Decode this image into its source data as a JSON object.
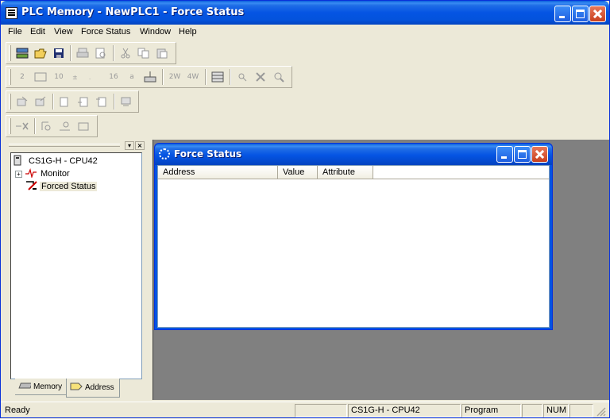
{
  "window": {
    "title": "PLC Memory - NewPLC1 - Force Status"
  },
  "menu": {
    "items": [
      {
        "label": "File"
      },
      {
        "label": "Edit"
      },
      {
        "label": "View"
      },
      {
        "label": "Force Status"
      },
      {
        "label": "Window"
      },
      {
        "label": "Help"
      }
    ]
  },
  "toolbar2": {
    "icons": [
      "2",
      "10",
      "16",
      "a"
    ],
    "word_icons": [
      "2W",
      "4W"
    ]
  },
  "tree": {
    "root": "CS1G-H - CPU42",
    "children": [
      {
        "label": "Monitor"
      },
      {
        "label": "Forced Status"
      }
    ]
  },
  "tabs": [
    {
      "label": "Memory"
    },
    {
      "label": "Address"
    }
  ],
  "child_window": {
    "title": "Force Status",
    "columns": [
      "Address",
      "Value",
      "Attribute"
    ]
  },
  "status": {
    "text": "Ready",
    "plc": "CS1G-H - CPU42",
    "mode": "Program",
    "num": "NUM"
  }
}
